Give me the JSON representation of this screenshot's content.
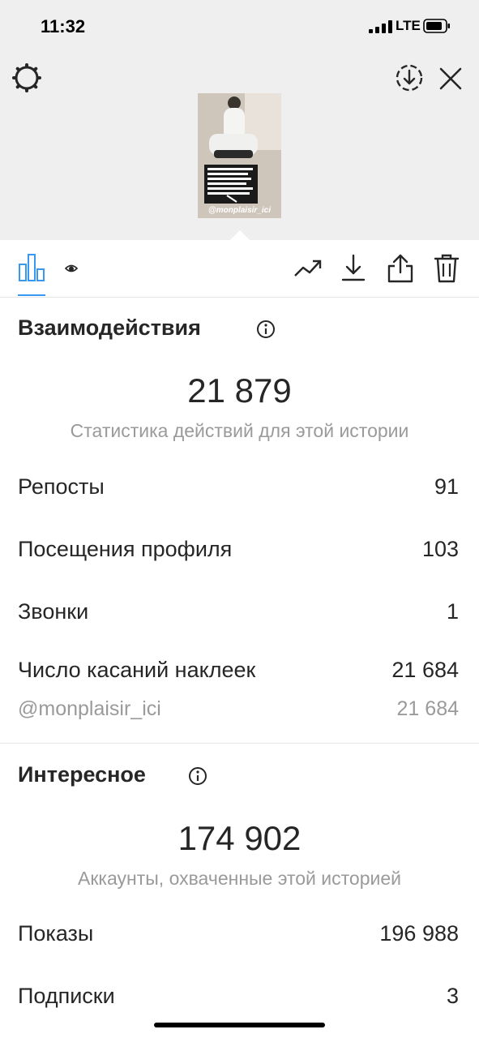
{
  "status_bar": {
    "time": "11:32",
    "network": "LTE"
  },
  "header": {
    "settings_icon": "gear-icon",
    "download_icon": "download-circle-icon",
    "close_icon": "close-icon",
    "story_thumbnail": {
      "handle": "@monplaisir_ici"
    }
  },
  "toolbar": {
    "tabs": [
      {
        "icon": "bar-chart-icon",
        "active": true
      },
      {
        "icon": "eye-icon",
        "active": false
      }
    ],
    "actions": [
      "trending-icon",
      "download-icon",
      "share-icon",
      "trash-icon"
    ],
    "accent_color": "#3897f0"
  },
  "interactions": {
    "title": "Взаимодействия",
    "total": "21 879",
    "caption": "Статистика действий для этой истории",
    "rows": [
      {
        "label": "Репосты",
        "value": "91"
      },
      {
        "label": "Посещения профиля",
        "value": "103"
      },
      {
        "label": "Звонки",
        "value": "1"
      },
      {
        "label": "Число касаний наклеек",
        "value": "21 684"
      }
    ],
    "sub_row": {
      "label": "@monplaisir_ici",
      "value": "21 684"
    }
  },
  "discovery": {
    "title": "Интересное",
    "total": "174 902",
    "caption": "Аккаунты, охваченные этой историей",
    "rows": [
      {
        "label": "Показы",
        "value": "196 988"
      },
      {
        "label": "Подписки",
        "value": "3"
      }
    ]
  }
}
